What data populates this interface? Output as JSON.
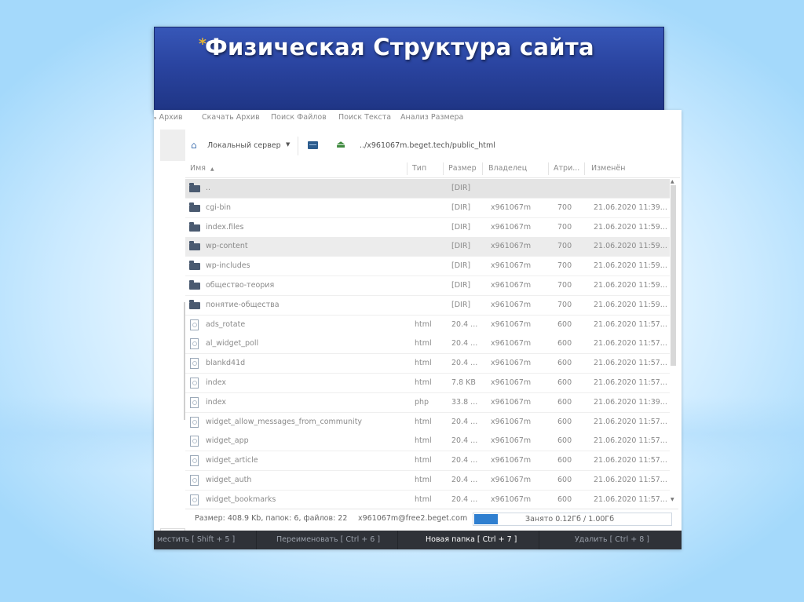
{
  "slide": {
    "bullet": "*",
    "title": "Физическая Структура сайта"
  },
  "menu": [
    {
      "label": "ь Архив",
      "state": "dim"
    },
    {
      "label": "Скачать Архив",
      "state": "dim"
    },
    {
      "label": "Поиск Файлов",
      "state": "strong"
    },
    {
      "label": "Поиск Текста",
      "state": "strong"
    },
    {
      "label": "Анализ Размера",
      "state": "strong"
    }
  ],
  "toolbar": {
    "home_icon": "home-icon",
    "server_label": "Локальный сервер",
    "caret": "▼",
    "drive_icon": "server-drive-icon",
    "upload_icon": "upload-icon",
    "path": "../x961067m.beget.tech/public_html"
  },
  "columns": {
    "name": "Имя",
    "sort_arrow": "▲",
    "type": "Тип",
    "size": "Размер",
    "owner": "Владелец",
    "attr": "Атри...",
    "modified": "Изменён"
  },
  "rows": [
    {
      "icon": "folder",
      "name": "..",
      "type": "",
      "size": "[DIR]",
      "owner": "",
      "attr": "",
      "modified": "",
      "state": "updir"
    },
    {
      "icon": "folder",
      "name": "cgi-bin",
      "type": "",
      "size": "[DIR]",
      "owner": "x961067m",
      "attr": "700",
      "modified": "21.06.2020 11:39...",
      "state": ""
    },
    {
      "icon": "folder",
      "name": "index.files",
      "type": "",
      "size": "[DIR]",
      "owner": "x961067m",
      "attr": "700",
      "modified": "21.06.2020 11:59...",
      "state": ""
    },
    {
      "icon": "folder",
      "name": "wp-content",
      "type": "",
      "size": "[DIR]",
      "owner": "x961067m",
      "attr": "700",
      "modified": "21.06.2020 11:59...",
      "state": "sel"
    },
    {
      "icon": "folder",
      "name": "wp-includes",
      "type": "",
      "size": "[DIR]",
      "owner": "x961067m",
      "attr": "700",
      "modified": "21.06.2020 11:59...",
      "state": ""
    },
    {
      "icon": "folder",
      "name": "общество-теория",
      "type": "",
      "size": "[DIR]",
      "owner": "x961067m",
      "attr": "700",
      "modified": "21.06.2020 11:59...",
      "state": ""
    },
    {
      "icon": "folder",
      "name": "понятие-общества",
      "type": "",
      "size": "[DIR]",
      "owner": "x961067m",
      "attr": "700",
      "modified": "21.06.2020 11:59...",
      "state": ""
    },
    {
      "icon": "file",
      "name": "ads_rotate",
      "type": "html",
      "size": "20.4 ...",
      "owner": "x961067m",
      "attr": "600",
      "modified": "21.06.2020 11:57...",
      "state": ""
    },
    {
      "icon": "file",
      "name": "al_widget_poll",
      "type": "html",
      "size": "20.4 ...",
      "owner": "x961067m",
      "attr": "600",
      "modified": "21.06.2020 11:57...",
      "state": ""
    },
    {
      "icon": "file",
      "name": "blankd41d",
      "type": "html",
      "size": "20.4 ...",
      "owner": "x961067m",
      "attr": "600",
      "modified": "21.06.2020 11:57...",
      "state": ""
    },
    {
      "icon": "file",
      "name": "index",
      "type": "html",
      "size": "7.8 KB",
      "owner": "x961067m",
      "attr": "600",
      "modified": "21.06.2020 11:57...",
      "state": ""
    },
    {
      "icon": "file",
      "name": "index",
      "type": "php",
      "size": "33.8 ...",
      "owner": "x961067m",
      "attr": "600",
      "modified": "21.06.2020 11:39...",
      "state": ""
    },
    {
      "icon": "file",
      "name": "widget_allow_messages_from_community",
      "type": "html",
      "size": "20.4 ...",
      "owner": "x961067m",
      "attr": "600",
      "modified": "21.06.2020 11:57...",
      "state": ""
    },
    {
      "icon": "file",
      "name": "widget_app",
      "type": "html",
      "size": "20.4 ...",
      "owner": "x961067m",
      "attr": "600",
      "modified": "21.06.2020 11:57...",
      "state": ""
    },
    {
      "icon": "file",
      "name": "widget_article",
      "type": "html",
      "size": "20.4 ...",
      "owner": "x961067m",
      "attr": "600",
      "modified": "21.06.2020 11:57...",
      "state": ""
    },
    {
      "icon": "file",
      "name": "widget_auth",
      "type": "html",
      "size": "20.4 ...",
      "owner": "x961067m",
      "attr": "600",
      "modified": "21.06.2020 11:57...",
      "state": ""
    },
    {
      "icon": "file",
      "name": "widget_bookmarks",
      "type": "html",
      "size": "20.4 ...",
      "owner": "x961067m",
      "attr": "600",
      "modified": "21.06.2020 11:57...",
      "state": ""
    }
  ],
  "status": {
    "summary": "Размер: 408.9 Kb, папок: 6, файлов: 22",
    "account": "x961067m@free2.beget.com",
    "quota_text": "Занято 0.12Гб / 1.00Гб",
    "quota_fraction": 0.12
  },
  "function_keys": [
    {
      "label": "местить [ Shift + 5 ]",
      "active": false
    },
    {
      "label": "Переименовать [ Ctrl + 6 ]",
      "active": false
    },
    {
      "label": "Новая папка [ Ctrl + 7 ]",
      "active": true
    },
    {
      "label": "Удалить [ Ctrl + 8 ]",
      "active": false
    }
  ],
  "colors": {
    "title_bg": "#2a44a0",
    "bullet": "#e6b432",
    "quota_fill": "#2f7fd0",
    "fkey_bar": "#2f3238"
  }
}
